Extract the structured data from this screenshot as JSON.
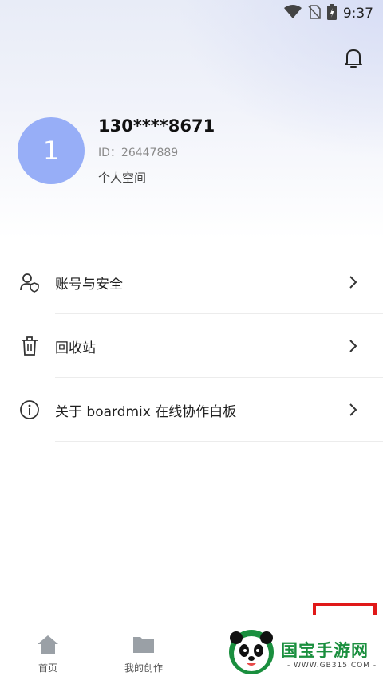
{
  "status_bar": {
    "time": "9:37"
  },
  "profile": {
    "avatar_initial": "1",
    "phone": "130****8671",
    "id": "ID：26447889",
    "space": "个人空间"
  },
  "menu": {
    "items": [
      {
        "label": "账号与安全",
        "icon": "user-security-icon"
      },
      {
        "label": "回收站",
        "icon": "trash-icon"
      },
      {
        "label": "关于 boardmix 在线协作白板",
        "icon": "info-icon"
      }
    ]
  },
  "tabbar": {
    "tabs": [
      {
        "label": "首页",
        "icon": "home-icon"
      },
      {
        "label": "我的创作",
        "icon": "folder-icon"
      }
    ]
  },
  "watermark": {
    "text": "国宝手游网",
    "url": "- WWW.GB315.COM -"
  },
  "colors": {
    "avatar": "#97aef7",
    "highlight_box": "#e01818",
    "watermark_green": "#1a8f3e"
  }
}
